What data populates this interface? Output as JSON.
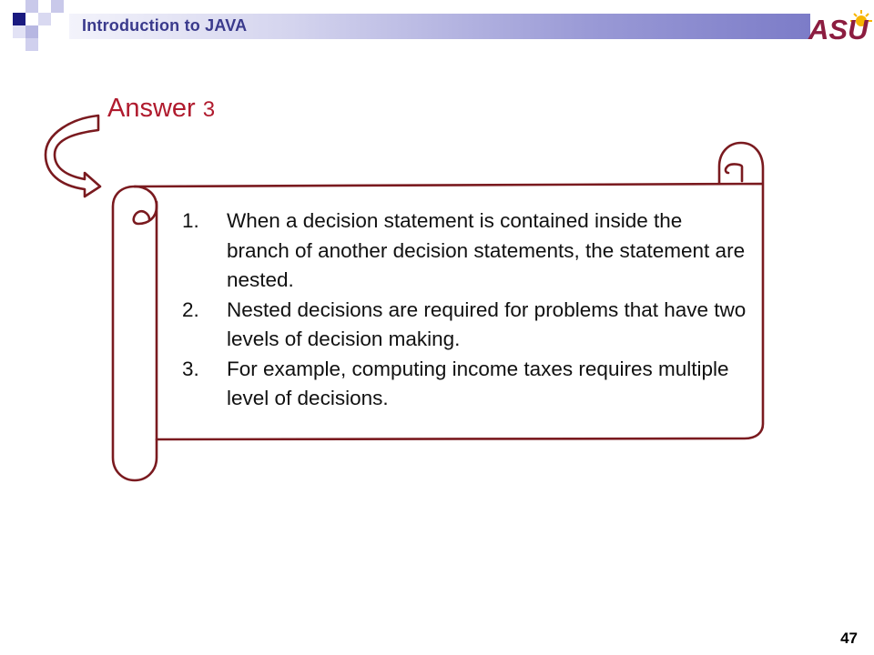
{
  "header": {
    "title": "Introduction to JAVA",
    "logo_text": "ASU",
    "colors": {
      "title": "#3a3a8c",
      "logo": "#8c1d40",
      "accent": "#f7b500"
    }
  },
  "answer": {
    "heading": "Answer",
    "number": "3",
    "heading_color": "#b01b2e"
  },
  "list": [
    {
      "marker": "1.",
      "text": "When a decision statement is contained inside the branch of another decision statements, the statement are nested."
    },
    {
      "marker": "2.",
      "text": "Nested decisions are required for problems that have two levels of decision making."
    },
    {
      "marker": "3.",
      "text": "For example, computing income taxes requires multiple level of decisions."
    }
  ],
  "page_number": "47",
  "scroll_color": "#7a1a1f"
}
